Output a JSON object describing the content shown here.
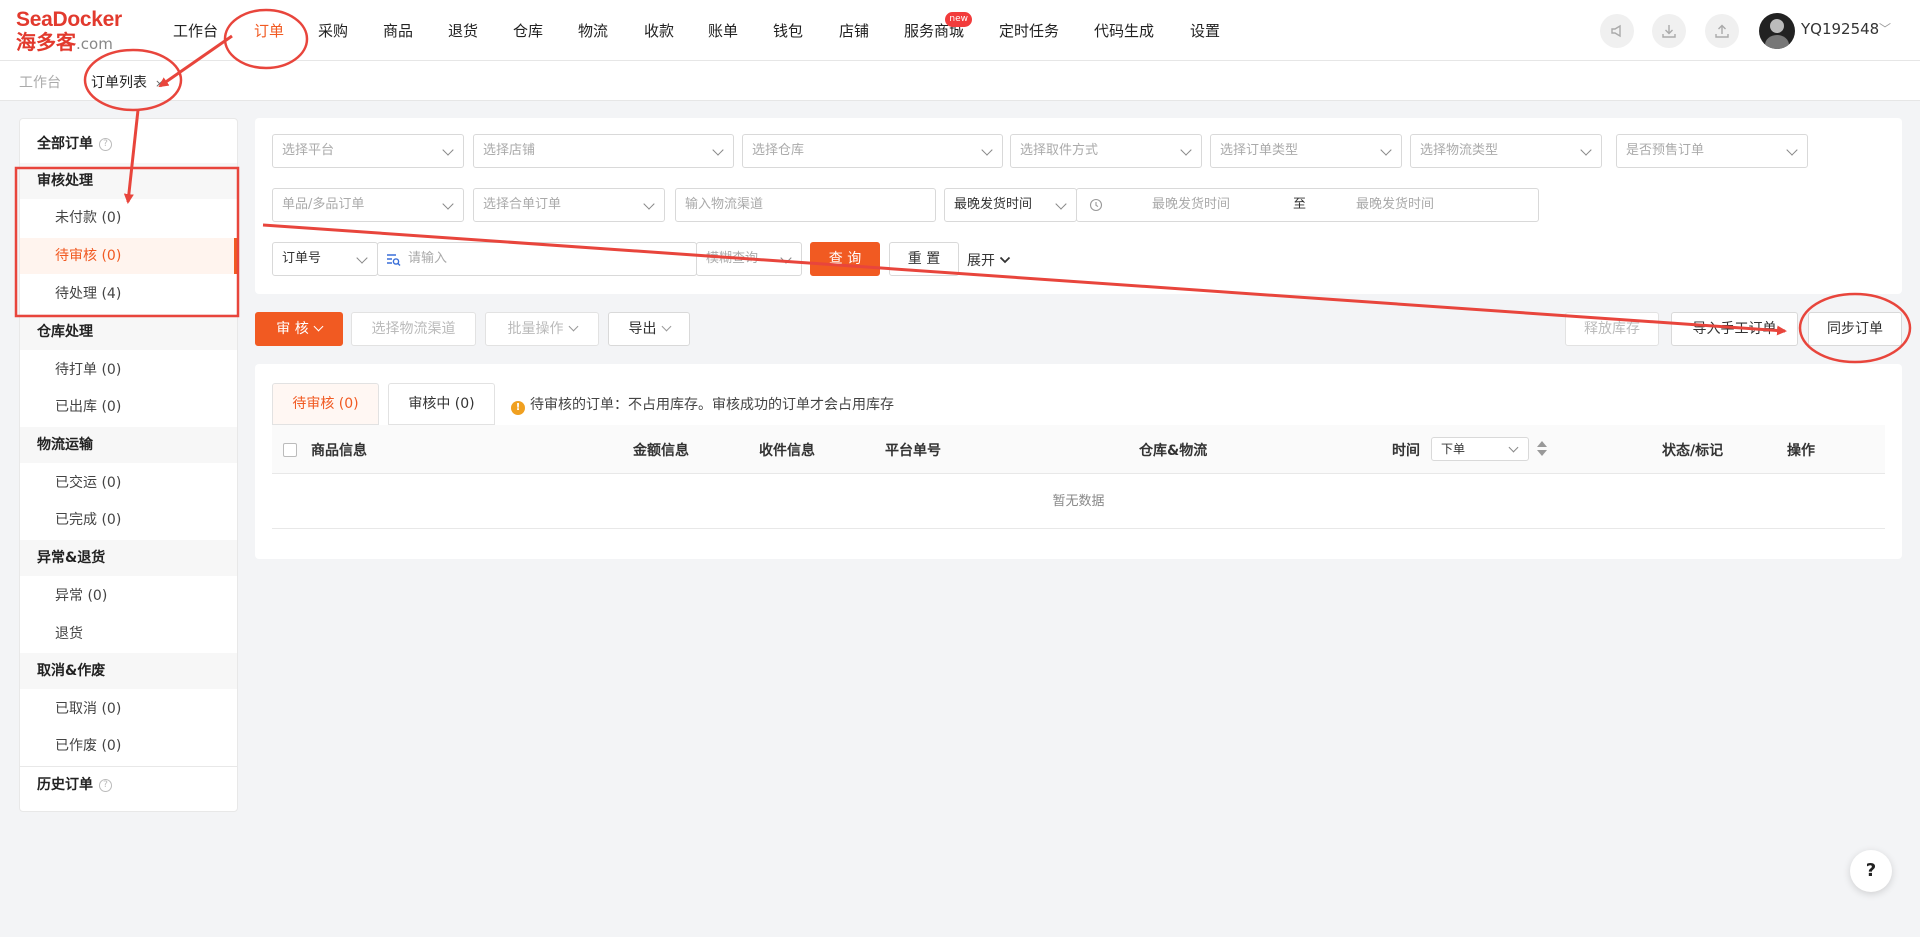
{
  "logo": {
    "line1_a": "Sea",
    "line1_b": "Docker",
    "line2_a": "海多客",
    "line2_b": ".com"
  },
  "nav": [
    {
      "label": "工作台"
    },
    {
      "label": "订单"
    },
    {
      "label": "采购"
    },
    {
      "label": "商品"
    },
    {
      "label": "退货"
    },
    {
      "label": "仓库"
    },
    {
      "label": "物流"
    },
    {
      "label": "收款"
    },
    {
      "label": "账单"
    },
    {
      "label": "钱包"
    },
    {
      "label": "店铺"
    },
    {
      "label": "服务商城"
    },
    {
      "label": "定时任务"
    },
    {
      "label": "代码生成"
    },
    {
      "label": "设置"
    }
  ],
  "nav_badge": "new",
  "user": {
    "name": "YQ192548"
  },
  "tabs": {
    "home": "工作台",
    "current": "订单列表",
    "close": "×"
  },
  "sidebar": {
    "all_orders": "全部订单",
    "help": "?",
    "groups": [
      {
        "title": "审核处理",
        "items": [
          "未付款 (0)",
          "待审核 (0)",
          "待处理 (4)"
        ]
      },
      {
        "title": "仓库处理",
        "items": [
          "待打单 (0)",
          "已出库 (0)"
        ]
      },
      {
        "title": "物流运输",
        "items": [
          "已交运 (0)",
          "已完成 (0)"
        ]
      },
      {
        "title": "异常&退货",
        "items": [
          "异常 (0)",
          "退货"
        ]
      },
      {
        "title": "取消&作废",
        "items": [
          "已取消 (0)",
          "已作废 (0)"
        ]
      }
    ],
    "history": "历史订单"
  },
  "filters": {
    "row1": [
      "选择平台",
      "选择店铺",
      "选择仓库",
      "选择取件方式",
      "选择订单类型",
      "选择物流类型",
      "是否预售订单"
    ],
    "row2": [
      "单品/多品订单",
      "选择合单订单",
      "输入物流渠道"
    ],
    "time_type": "最晚发货时间",
    "start_placeholder": "最晚发货时间",
    "to": "至",
    "end_placeholder": "最晚发货时间",
    "order_no": "订单号",
    "search_placeholder": "请输入",
    "match_mode": "模糊查询",
    "search_btn": "查 询",
    "reset_btn": "重 置",
    "expand": "展开"
  },
  "toolbar": {
    "audit": "审 核",
    "select_channel": "选择物流渠道",
    "batch": "批量操作",
    "export": "导出",
    "release": "释放库存",
    "import_manual": "导入手工订单",
    "sync": "同步订单"
  },
  "subtabs": [
    {
      "label": "待审核",
      "count": "(0)"
    },
    {
      "label": "审核中",
      "count": "(0)"
    }
  ],
  "notice": "待审核的订单：不占用库存。审核成功的订单才会占用库存",
  "notice_icon": "!",
  "table": {
    "columns": [
      "商品信息",
      "金额信息",
      "收件信息",
      "平台单号",
      "仓库&物流",
      "时间",
      "状态/标记",
      "操作"
    ],
    "time_sort": "下单",
    "empty": "暂无数据"
  },
  "help_fab": "?",
  "colors": {
    "accent": "#f15a22",
    "annotation": "#e8453c"
  }
}
